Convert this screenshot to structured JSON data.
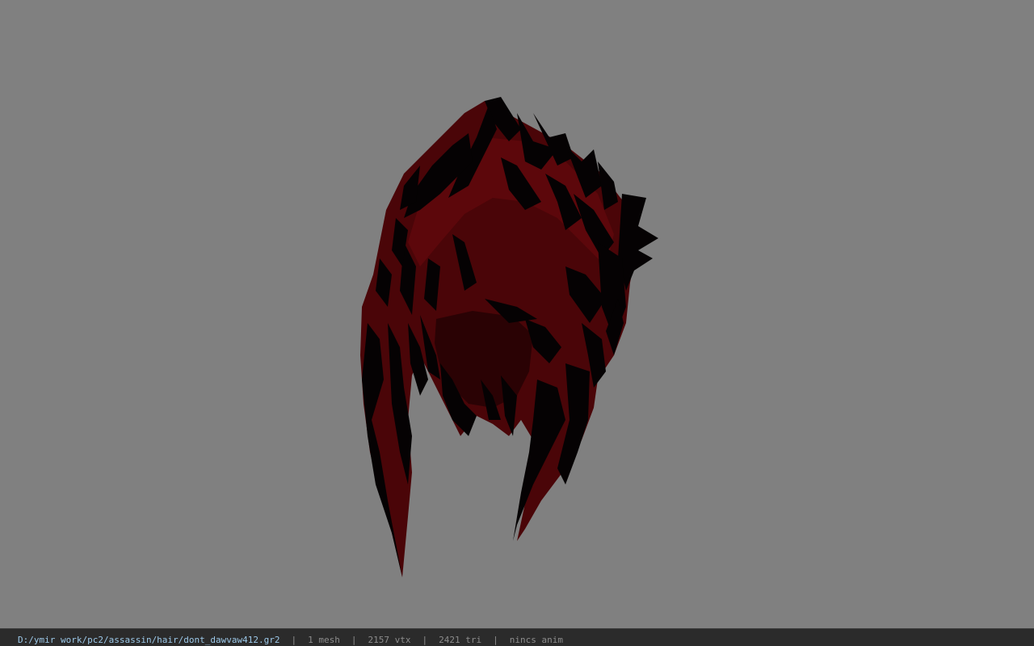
{
  "viewer": {
    "background_color": "#808080",
    "model": {
      "name": "hair-mesh",
      "colors": {
        "base": "#4a0508",
        "mid": "#5c070b",
        "shadow": "#2a0204",
        "strand": "#050203"
      }
    }
  },
  "status": {
    "file_path": "D:/ymir work/pc2/assassin/hair/dont_dawvaw412.gr2",
    "separator": "|",
    "mesh_count": "1 mesh",
    "vertex_count": "2157 vtx",
    "triangle_count": "2421 tri",
    "anim_status": "nincs anim"
  }
}
